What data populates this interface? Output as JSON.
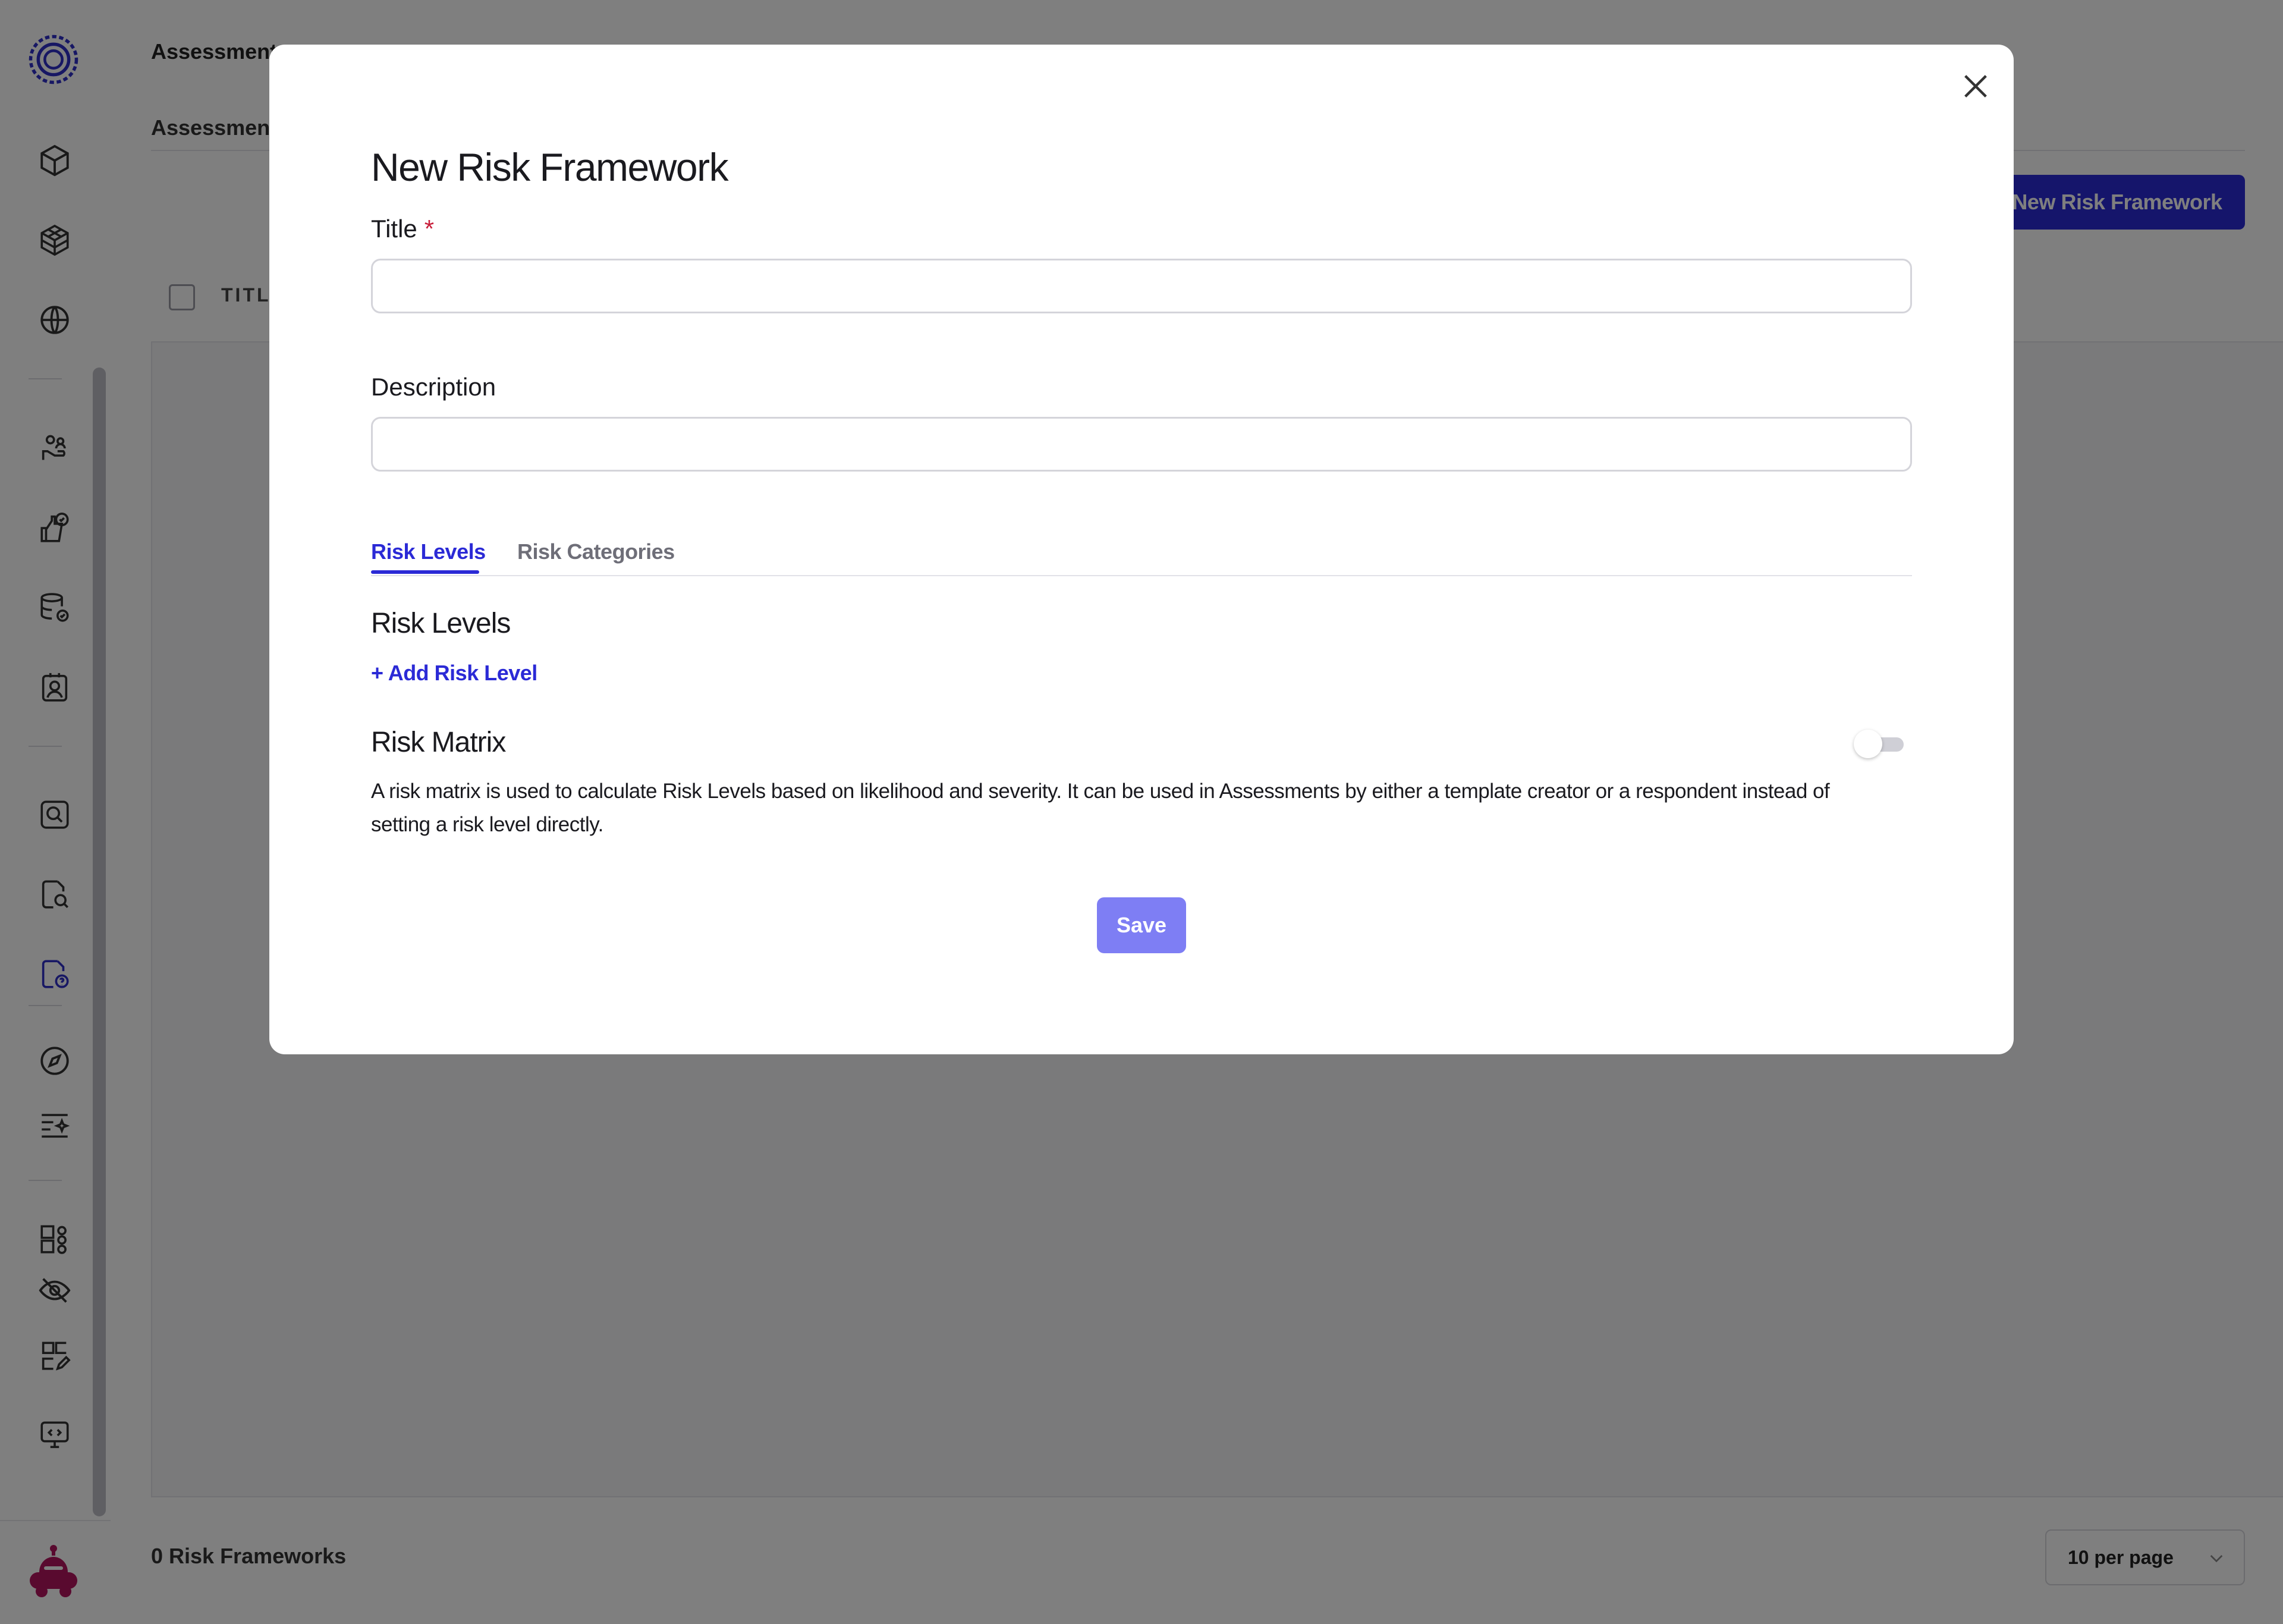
{
  "background": {
    "breadcrumb": "Assessment",
    "tab": "Assessment",
    "new_framework_button": "New Risk Framework",
    "table_header_title": "TITL",
    "footer_count": "0 Risk Frameworks",
    "per_page": "10 per page"
  },
  "sidebar": {
    "icons": [
      "logo-icon",
      "cube-icon",
      "cubes-icon",
      "globe-icon",
      "people-hand-icon",
      "thumbs-check-icon",
      "database-check-icon",
      "contact-card-icon",
      "search-box-icon",
      "doc-search-icon",
      "doc-question-icon",
      "compass-icon",
      "list-sparkle-icon",
      "app-grid-icon",
      "eye-off-icon",
      "grid-edit-icon",
      "monitor-code-icon",
      "avatar-robot-icon"
    ]
  },
  "modal": {
    "title": "New Risk Framework",
    "title_label": "Title",
    "required_mark": "*",
    "title_value": "",
    "description_label": "Description",
    "description_value": "",
    "tabs": [
      {
        "label": "Risk Levels",
        "active": true
      },
      {
        "label": "Risk Categories",
        "active": false
      }
    ],
    "risk_levels_heading": "Risk Levels",
    "add_risk_level": "+ Add Risk Level",
    "risk_matrix_heading": "Risk Matrix",
    "risk_matrix_description": "A risk matrix is used to calculate Risk Levels based on likelihood and severity. It can be used in Assessments by either a template creator or a respondent instead of setting a risk level directly.",
    "risk_matrix_enabled": false,
    "save_label": "Save"
  },
  "colors": {
    "accent": "#2b2ad6",
    "save_button": "#7e7ef4",
    "required": "#c81e3a",
    "brand_logo": "#2f2fc8",
    "avatar": "#b3155f"
  }
}
